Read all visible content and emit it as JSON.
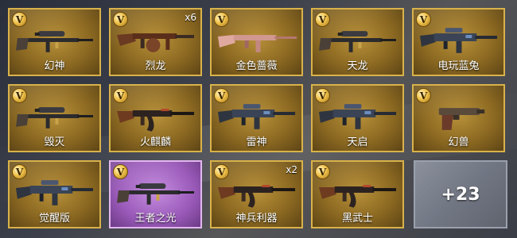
{
  "badge_letter": "V",
  "items": [
    {
      "name": "幻神",
      "count": "",
      "icon": "sniper-rifle-icon",
      "style": "gold"
    },
    {
      "name": "烈龙",
      "count": "x6",
      "icon": "tommy-gun-icon",
      "style": "gold"
    },
    {
      "name": "金色蔷薇",
      "count": "",
      "icon": "rifle-icon",
      "style": "gold"
    },
    {
      "name": "天龙",
      "count": "",
      "icon": "sniper-rifle-icon",
      "style": "gold"
    },
    {
      "name": "电玩蓝兔",
      "count": "",
      "icon": "assault-rifle-icon",
      "style": "gold"
    },
    {
      "name": "毁灭",
      "count": "",
      "icon": "sniper-rifle-icon",
      "style": "gold"
    },
    {
      "name": "火麒麟",
      "count": "",
      "icon": "ak-rifle-icon",
      "style": "gold"
    },
    {
      "name": "雷神",
      "count": "",
      "icon": "assault-rifle-icon",
      "style": "gold"
    },
    {
      "name": "天启",
      "count": "",
      "icon": "assault-rifle-icon",
      "style": "gold"
    },
    {
      "name": "幻兽",
      "count": "",
      "icon": "pistol-icon",
      "style": "gold"
    },
    {
      "name": "觉醒版",
      "count": "",
      "icon": "assault-rifle-icon",
      "style": "gold"
    },
    {
      "name": "王者之光",
      "count": "",
      "icon": "sniper-rifle-icon",
      "style": "purple"
    },
    {
      "name": "神兵利器",
      "count": "x2",
      "icon": "ak-rifle-icon",
      "style": "gold"
    },
    {
      "name": "黑武士",
      "count": "",
      "icon": "ak-rifle-icon",
      "style": "gold"
    }
  ],
  "more_label": "+23",
  "colors": {
    "gold_border": "#d9b24a",
    "purple_border": "#e3b6f0",
    "more_bg": "#727784"
  }
}
